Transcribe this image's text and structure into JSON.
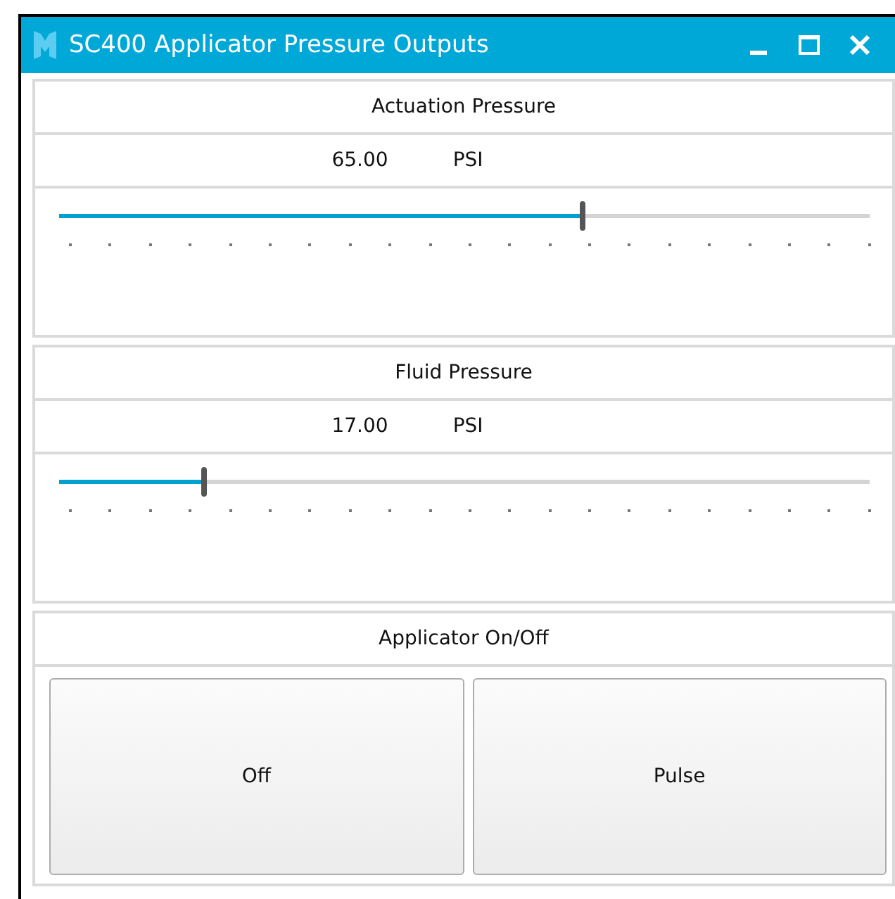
{
  "window": {
    "title": "SC400 Applicator Pressure Outputs"
  },
  "pressures": [
    {
      "title": "Actuation Pressure",
      "value": "65.00",
      "unit": "PSI",
      "level": 0.646
    },
    {
      "title": "Fluid Pressure",
      "value": "17.00",
      "unit": "PSI",
      "level": 0.179
    }
  ],
  "applicator": {
    "title": "Applicator On/Off",
    "buttons": [
      "Off",
      "Pulse"
    ]
  }
}
